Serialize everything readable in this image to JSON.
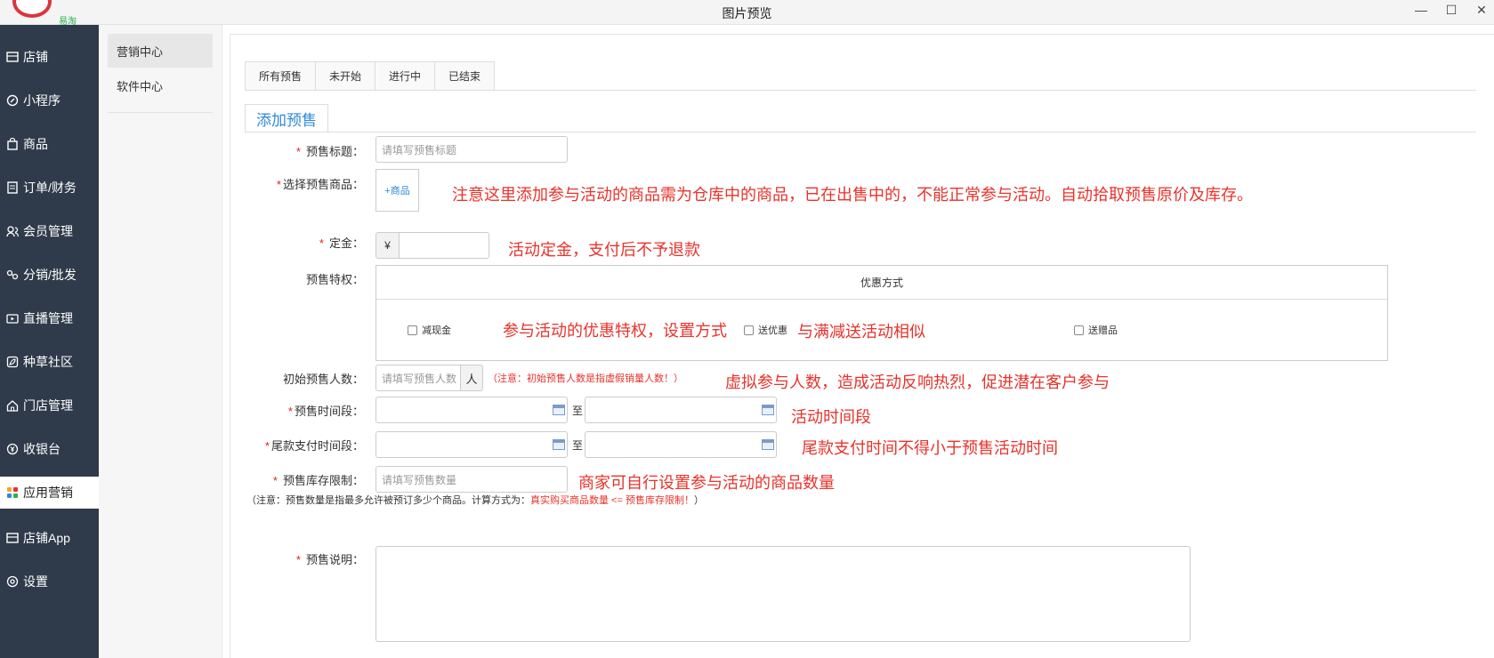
{
  "window": {
    "title": "图片预览",
    "logo_text": "易淘"
  },
  "sidebar": {
    "items": [
      {
        "label": "店铺",
        "icon": "store-icon"
      },
      {
        "label": "小程序",
        "icon": "compass-icon"
      },
      {
        "label": "商品",
        "icon": "bag-icon"
      },
      {
        "label": "订单/财务",
        "icon": "document-icon"
      },
      {
        "label": "会员管理",
        "icon": "users-icon"
      },
      {
        "label": "分销/批发",
        "icon": "share-icon"
      },
      {
        "label": "直播管理",
        "icon": "video-icon"
      },
      {
        "label": "种草社区",
        "icon": "leaf-icon"
      },
      {
        "label": "门店管理",
        "icon": "house-icon"
      },
      {
        "label": "收银台",
        "icon": "yen-icon"
      },
      {
        "label": "应用营销",
        "icon": "apps-icon"
      },
      {
        "label": "店铺App",
        "icon": "store-app-icon"
      },
      {
        "label": "设置",
        "icon": "gear-icon"
      }
    ]
  },
  "subnav": {
    "items": [
      {
        "label": "营销中心"
      },
      {
        "label": "软件中心"
      }
    ]
  },
  "tabs": [
    {
      "label": "所有预售"
    },
    {
      "label": "未开始"
    },
    {
      "label": "进行中"
    },
    {
      "label": "已结束"
    }
  ],
  "section_tab": "添加预售",
  "form": {
    "title": {
      "label": "预售标题：",
      "placeholder": "请填写预售标题"
    },
    "product": {
      "label": "选择预售商品：",
      "button": "+商品",
      "note": "注意这里添加参与活动的商品需为仓库中的商品，已在出售中的，不能正常参与活动。自动拾取预售原价及库存。"
    },
    "deposit": {
      "label": "定金：",
      "currency": "¥",
      "note": "活动定金，支付后不予退款"
    },
    "privilege": {
      "label": "预售特权：",
      "header": "优惠方式",
      "options": [
        "减现金",
        "送优惠",
        "送赠品"
      ],
      "note1": "参与活动的优惠特权，设置方式",
      "note2": "与满减送活动相似"
    },
    "initial": {
      "label": "初始预售人数：",
      "placeholder": "请填写预售人数",
      "unit": "人",
      "hint": "（注意：初始预售人数是指虚假销量人数！）",
      "note": "虚拟参与人数，造成活动反响热烈，促进潜在客户参与"
    },
    "period": {
      "label": "预售时间段：",
      "to": "至",
      "note": "活动时间段"
    },
    "final_pay": {
      "label": "尾款支付时间段：",
      "to": "至",
      "note": "尾款支付时间不得小于预售活动时间"
    },
    "stock": {
      "label": "预售库存限制：",
      "placeholder": "请填写预售数量",
      "note": "商家可自行设置参与活动的商品数量"
    },
    "footnote_prefix": "（注意：预售数量是指最多允许被预订多少个商品。计算方式为：",
    "footnote_red": "真实购买商品数量 <= 预售库存限制！",
    "footnote_suffix": "）",
    "description": {
      "label": "预售说明："
    }
  },
  "colors": {
    "sidebar_bg": "#2f3b4a",
    "accent": "#2f8ad8",
    "annotation_red": "#e8322b"
  }
}
